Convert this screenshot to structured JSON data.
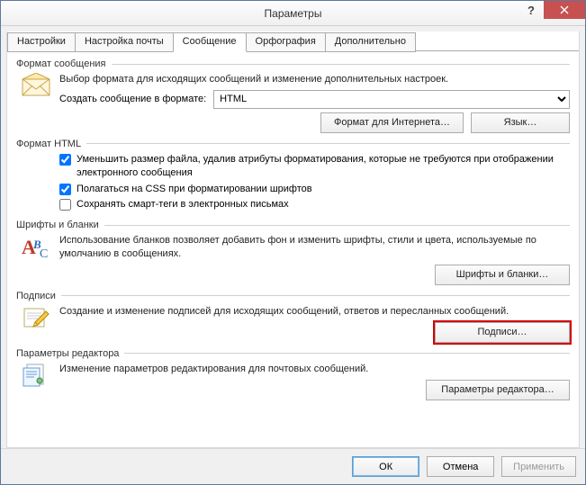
{
  "window": {
    "title": "Параметры"
  },
  "tabs": [
    {
      "label": "Настройки"
    },
    {
      "label": "Настройка почты"
    },
    {
      "label": "Сообщение"
    },
    {
      "label": "Орфография"
    },
    {
      "label": "Дополнительно"
    }
  ],
  "group_format": {
    "title": "Формат сообщения",
    "desc": "Выбор формата для исходящих сообщений и изменение дополнительных настроек.",
    "combo_label": "Создать сообщение в формате:",
    "combo_value": "HTML",
    "btn_internet": "Формат для Интернета…",
    "btn_lang": "Язык…"
  },
  "group_html": {
    "title": "Формат HTML",
    "chk1": "Уменьшить размер файла, удалив атрибуты форматирования, которые не требуются при отображении электронного сообщения",
    "chk2": "Полагаться на CSS при форматировании шрифтов",
    "chk3": "Сохранять смарт-теги в электронных письмах"
  },
  "group_fonts": {
    "title": "Шрифты и бланки",
    "desc": "Использование бланков позволяет добавить фон и изменить шрифты, стили и цвета, используемые по умолчанию в сообщениях.",
    "btn": "Шрифты и бланки…"
  },
  "group_sign": {
    "title": "Подписи",
    "desc": "Создание и изменение подписей для исходящих сообщений, ответов и пересланных сообщений.",
    "btn": "Подписи…"
  },
  "group_editor": {
    "title": "Параметры редактора",
    "desc": "Изменение параметров редактирования для почтовых сообщений.",
    "btn": "Параметры редактора…"
  },
  "buttons": {
    "ok": "ОК",
    "cancel": "Отмена",
    "apply": "Применить"
  }
}
